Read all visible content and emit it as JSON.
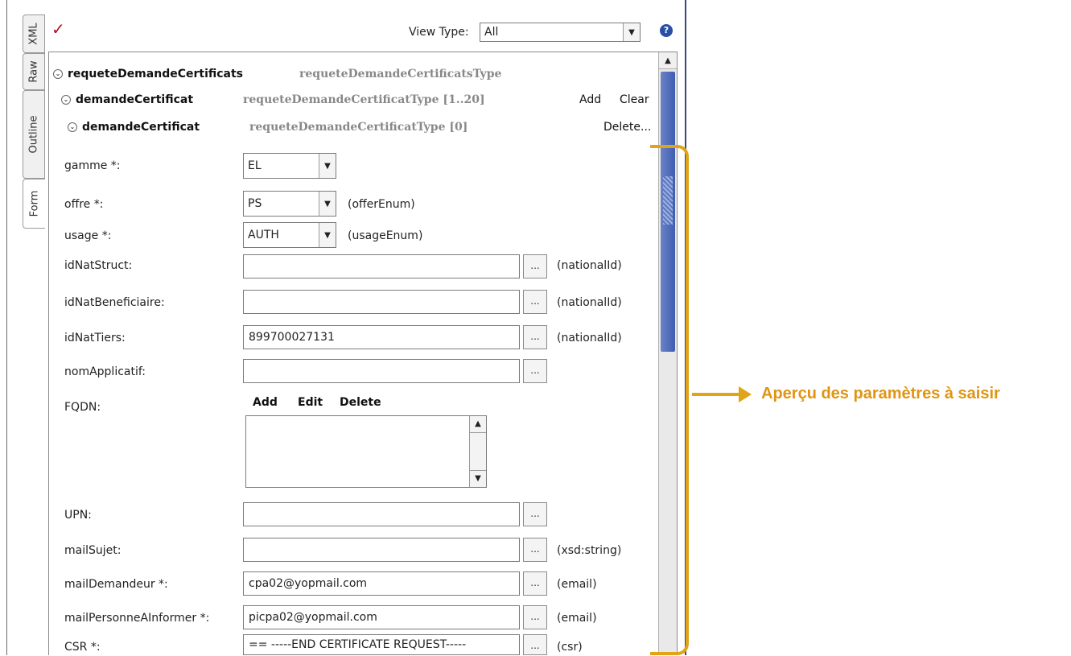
{
  "tabs": [
    "XML",
    "Raw",
    "Outline",
    "Form"
  ],
  "toolbar": {
    "view_type_label": "View Type:",
    "view_type_value": "All"
  },
  "tree": [
    {
      "name": "requeteDemandeCertificats",
      "type": "requeteDemandeCertificatsType"
    },
    {
      "name": "demandeCertificat",
      "type": "requeteDemandeCertificatType [1..20]",
      "actions": [
        "Add",
        "Clear"
      ]
    },
    {
      "name": "demandeCertificat",
      "type": "requeteDemandeCertificatType [0]",
      "actions": [
        "Delete..."
      ]
    }
  ],
  "fields": {
    "gamme": {
      "label": "gamme *:",
      "value": "EL"
    },
    "offre": {
      "label": "offre *:",
      "value": "PS",
      "type": "(offerEnum)"
    },
    "usage": {
      "label": "usage *:",
      "value": "AUTH",
      "type": "(usageEnum)"
    },
    "idNatStruct": {
      "label": "idNatStruct:",
      "value": "",
      "type": "(nationalId)"
    },
    "idNatBeneficiaire": {
      "label": "idNatBeneficiaire:",
      "value": "",
      "type": "(nationalId)"
    },
    "idNatTiers": {
      "label": "idNatTiers:",
      "value": "899700027131",
      "type": "(nationalId)"
    },
    "nomApplicatif": {
      "label": "nomApplicatif:",
      "value": ""
    },
    "fqdn": {
      "label": "FQDN:",
      "actions": [
        "Add",
        "Edit",
        "Delete"
      ]
    },
    "upn": {
      "label": "UPN:",
      "value": ""
    },
    "mailSujet": {
      "label": "mailSujet:",
      "value": "",
      "type": "(xsd:string)"
    },
    "mailDemandeur": {
      "label": "mailDemandeur *:",
      "value": "cpa02@yopmail.com",
      "type": "(email)"
    },
    "mailPersonne": {
      "label": "mailPersonneAInformer *:",
      "value": "picpa02@yopmail.com",
      "type": "(email)"
    },
    "csr": {
      "label": "CSR *:",
      "value": "== -----END CERTIFICATE REQUEST-----",
      "type": "(csr)"
    }
  },
  "ellipsis": "...",
  "annotation": "Aperçu des paramètres à saisir",
  "colors": {
    "accent": "#e0a416",
    "scroll_thumb": "#4a66b8",
    "checkmark": "#b01020"
  },
  "icons": [
    "checkmark-icon",
    "help-icon",
    "expand-icon",
    "dropdown-arrow-icon"
  ]
}
